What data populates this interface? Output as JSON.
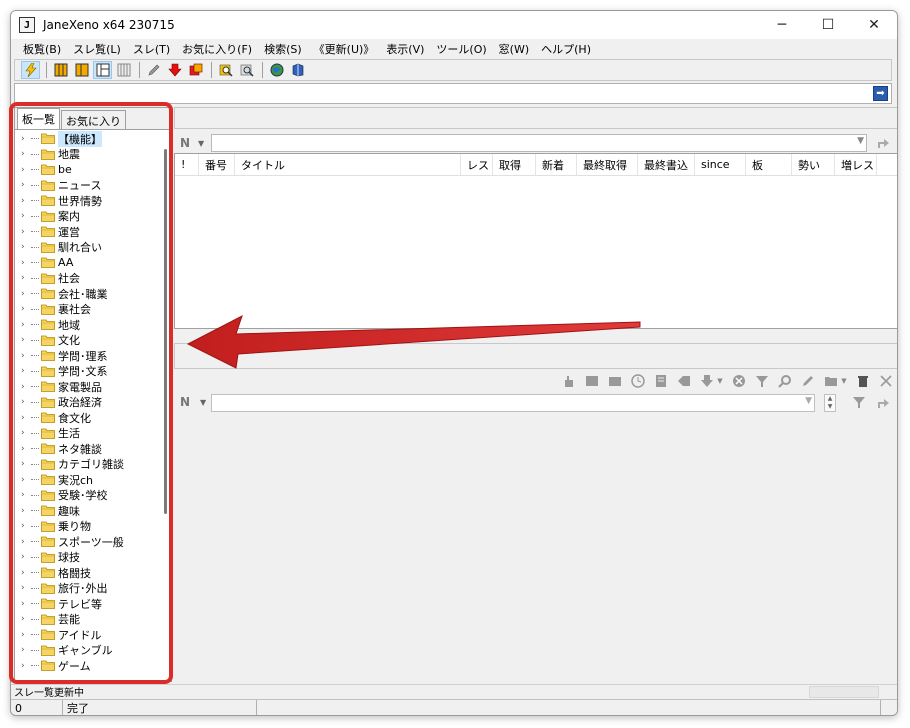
{
  "window": {
    "title": "JaneXeno x64 230715",
    "app_icon": "J"
  },
  "window_controls": {
    "minimize": "─",
    "maximize": "☐",
    "close": "✕"
  },
  "menu": [
    "板覧(B)",
    "スレ覧(L)",
    "スレ(T)",
    "お気に入り(F)",
    "検索(S)",
    "《更新(U)》",
    "表示(V)",
    "ツール(O)",
    "窓(W)",
    "ヘルプ(H)"
  ],
  "left_panel": {
    "tabs": [
      "板一覧",
      "お気に入り"
    ],
    "categories": [
      "【機能】",
      "地震",
      "be",
      "ニュース",
      "世界情勢",
      "案内",
      "運営",
      "馴れ合い",
      "AA",
      "社会",
      "会社･職業",
      "裏社会",
      "地域",
      "文化",
      "学問･理系",
      "学問･文系",
      "家電製品",
      "政治経済",
      "食文化",
      "生活",
      "ネタ雑談",
      "カテゴリ雑談",
      "実況ch",
      "受験･学校",
      "趣味",
      "乗り物",
      "スポーツ一般",
      "球技",
      "格闘技",
      "旅行･外出",
      "テレビ等",
      "芸能",
      "アイドル",
      "ギャンブル",
      "ゲーム"
    ]
  },
  "thread_list": {
    "columns": [
      "!",
      "番号",
      "タイトル",
      "レス",
      "取得",
      "新着",
      "最終取得",
      "最終書込",
      "since",
      "板",
      "勢い",
      "増レス"
    ]
  },
  "status": {
    "message": "スレ一覧更新中",
    "count": "0",
    "state": "完了"
  },
  "colors": {
    "highlight": "#dc2b2b",
    "selection": "#cce8ff",
    "accent": "#2a5db0"
  }
}
